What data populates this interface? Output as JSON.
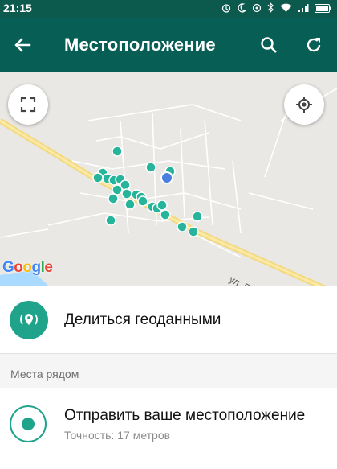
{
  "status_bar": {
    "time": "21:15",
    "icons": [
      "alarm-icon",
      "moon-icon",
      "hotspot-icon",
      "bluetooth-icon",
      "wifi-icon",
      "signal-icon",
      "battery-icon"
    ]
  },
  "app_bar": {
    "title": "Местоположение",
    "background": "#075e54",
    "icons": [
      "back-arrow-icon",
      "search-icon",
      "refresh-icon"
    ]
  },
  "map": {
    "logo": "Google",
    "street_label": "ул. Больш",
    "pin_color": "#26b59a",
    "current_location_color": "#4a7fe0"
  },
  "share": {
    "label": "Делиться геоданными",
    "accent": "#1fa38a"
  },
  "nearby": {
    "header": "Места рядом",
    "send_label": "Отправить ваше местоположение",
    "accuracy": "Точность: 17 метров"
  }
}
